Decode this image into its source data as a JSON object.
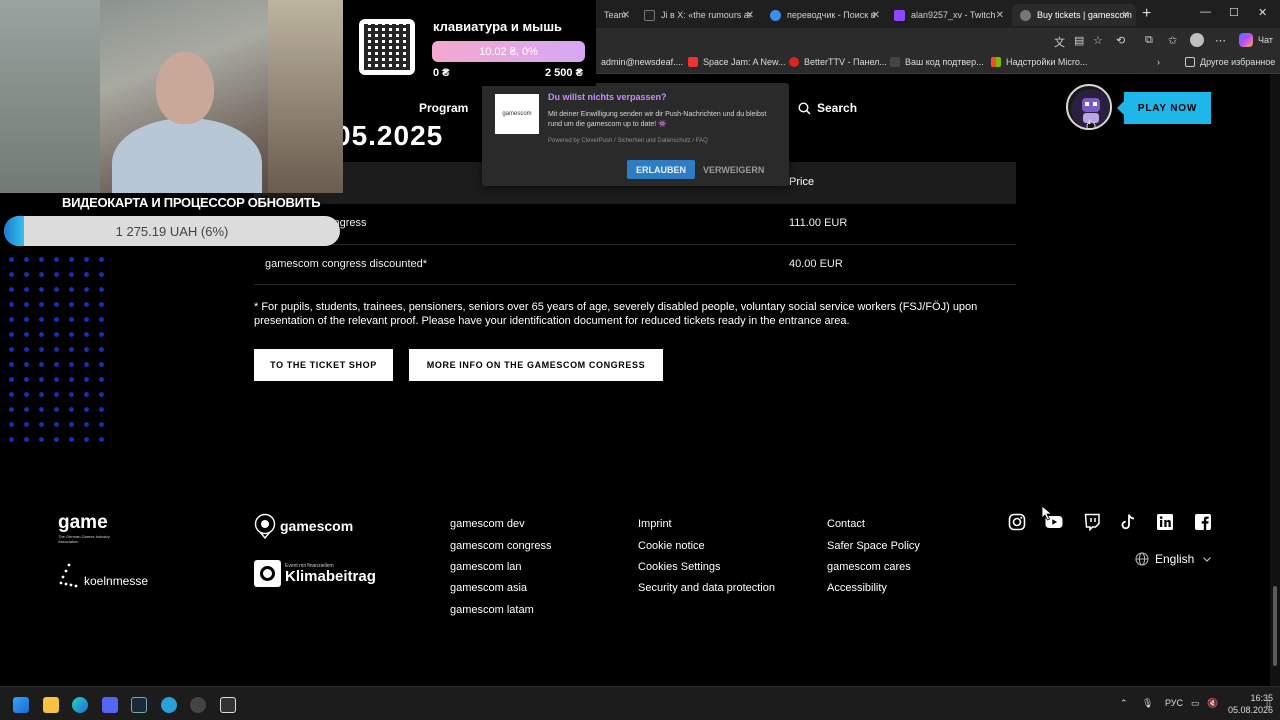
{
  "browser": {
    "tabs": [
      {
        "label": "Team",
        "close": "✕",
        "color": "#5a5a5a"
      },
      {
        "label": "Ji в X: «the rumours are",
        "close": "✕",
        "color": "#222"
      },
      {
        "label": "переводчик - Поиск в",
        "close": "✕",
        "color": "#3a8cf0"
      },
      {
        "label": "alan9257_xv - Twitch",
        "close": "✕",
        "color": "#9146ff"
      },
      {
        "label": "Buy tickets | gamescom",
        "close": "✕",
        "color": "#777",
        "active": true
      }
    ],
    "new_tab": "+",
    "window_controls": {
      "minimize": "—",
      "maximize": "☐",
      "close": "✕"
    },
    "chat_label": "Чат",
    "bookmarks": [
      {
        "label": "admin@newsdeaf....",
        "color": "#c33"
      },
      {
        "label": "Space Jam: A New...",
        "color": "#e33"
      },
      {
        "label": "BetterTTV - Панел...",
        "color": "#d22"
      },
      {
        "label": "Ваш код подтвер...",
        "color": "#444"
      },
      {
        "label": "Надстройки Micro...",
        "color": "#f25022"
      }
    ],
    "other_bookmarks": "Другое избранное"
  },
  "site": {
    "partial_heading": "05.2025",
    "nav": {
      "program": "Program",
      "search": "Search"
    },
    "mascot_badge": "1",
    "play_now": "PLAY NOW",
    "table": {
      "price_header": "Price",
      "rows": [
        {
          "name": "gamescom congress",
          "price": "111.00 EUR"
        },
        {
          "name": "gamescom congress discounted*",
          "price": "40.00 EUR"
        }
      ]
    },
    "footnote": "* For pupils, students, trainees, pensioners, seniors over 65 years of age, severely disabled people, voluntary social service workers (FSJ/FÖJ) upon presentation of the relevant proof. Please have your identification document for reduced tickets ready in the entrance area.",
    "buttons": {
      "ticket_shop": "TO THE TICKET SHOP",
      "more_info": "MORE INFO ON THE GAMESCOM CONGRESS"
    }
  },
  "footer": {
    "game_logo": "game",
    "game_sub": "The German Games Industry Association",
    "koeln_logo": "koelnmesse",
    "gc_logo": "gamescom",
    "klima_tiny": "Event mit finanziellem",
    "klima_big": "Klimabeitrag",
    "col1": [
      "gamescom dev",
      "gamescom congress",
      "gamescom lan",
      "gamescom asia",
      "gamescom latam"
    ],
    "col2": [
      "Imprint",
      "Cookie notice",
      "Cookies Settings",
      "Security and data protection"
    ],
    "col3": [
      "Contact",
      "Safer Space Policy",
      "gamescom cares",
      "Accessibility"
    ],
    "social": [
      "instagram-icon",
      "youtube-icon",
      "twitch-icon",
      "tiktok-icon",
      "linkedin-icon",
      "facebook-icon"
    ],
    "language": "English"
  },
  "push_popup": {
    "title": "Du willst nichts verpassen?",
    "body": "Mit deiner Einwilligung senden wir dir Push-Nachrichten und du bleibst rund um die gamescom up to date! 👾",
    "meta": "Powered by CleverPush  /  Sicherheit und Datenschutz  /  FAQ",
    "logo": "gamescom",
    "allow": "ERLAUBEN",
    "deny": "VERWEIGERN"
  },
  "overlay": {
    "donation_goal_1": {
      "title": "клавиатура и мышь",
      "progress": "10.02 ₴, 0%",
      "min": "0 ₴",
      "max": "2 500 ₴"
    },
    "donation_goal_2": {
      "title": "ВИДЕОКАРТА И ПРОЦЕССОР ОБНОВИТЬ",
      "progress": "1 275.19 UAH (6%)",
      "percent": 0.06
    }
  },
  "taskbar": {
    "lang": "РУС",
    "time": "16:35",
    "date": "05.08.2026"
  }
}
